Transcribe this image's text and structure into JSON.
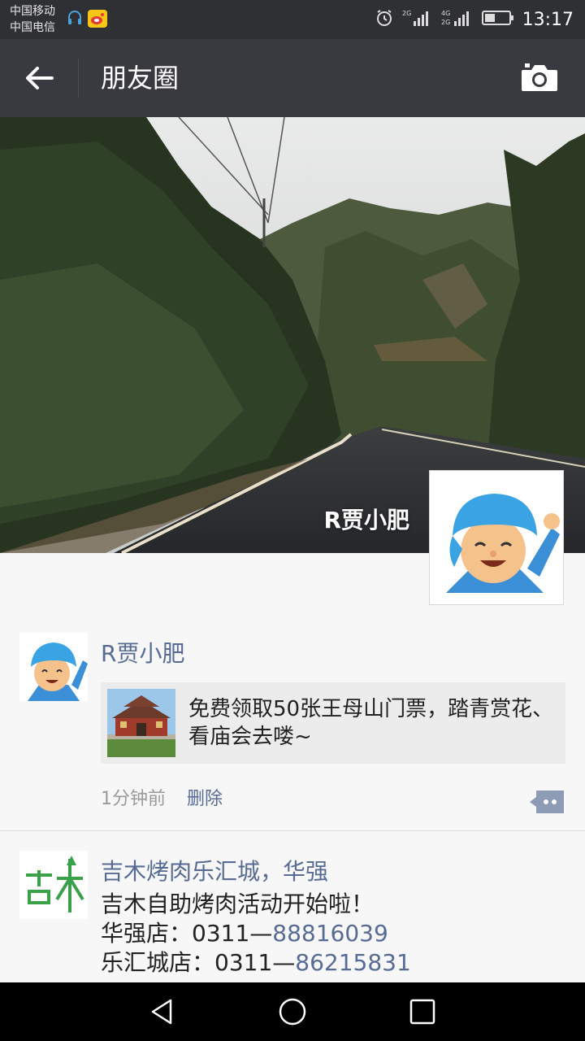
{
  "status_bar": {
    "carrier_1": "中国移动",
    "carrier_2": "中国电信",
    "time": "13:17",
    "net_1": "2G",
    "net_2": "4G",
    "net_3": "2G"
  },
  "header": {
    "title": "朋友圈",
    "back_icon": "arrow-left-icon",
    "camera_icon": "camera-icon"
  },
  "cover": {
    "username": "R贾小肥"
  },
  "posts": [
    {
      "author": "R贾小肥",
      "share_text": "免费领取50张王母山门票，踏青赏花、看庙会去喽~",
      "time": "1分钟前",
      "delete_label": "删除"
    },
    {
      "author": "吉木烤肉乐汇城，华强",
      "line_1": "吉木自助烤肉活动开始啦！",
      "line_2_prefix": "华强店：0311—",
      "line_2_number": "88816039",
      "line_3_prefix": "乐汇城店：0311—",
      "line_3_number": "86215831"
    }
  ],
  "colors": {
    "header_bg": "#393a3f",
    "link": "#576b95",
    "feed_bg": "#f7f7f7"
  }
}
